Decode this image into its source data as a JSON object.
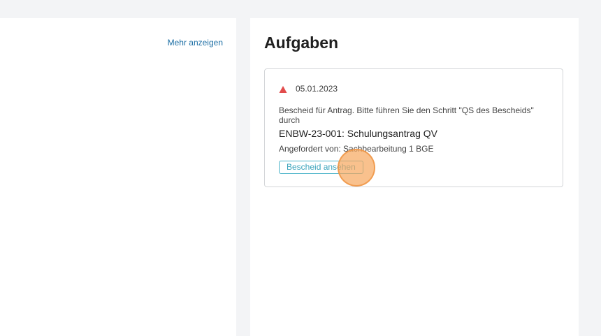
{
  "left_panel": {
    "more_link": "Mehr anzeigen"
  },
  "tasks_panel": {
    "title": "Aufgaben",
    "task": {
      "icon": "warning-triangle-icon",
      "icon_color": "#e24c4c",
      "date": "05.01.2023",
      "description": "Bescheid für Antrag. Bitte führen Sie den Schritt \"QS des Bescheids\" durch",
      "title": "ENBW-23-001: Schulungsantrag QV",
      "requested_by": "Angefordert von: Sachbearbeitung 1 BGE",
      "button_label": "Bescheid ansehen"
    }
  },
  "colors": {
    "link": "#1d6fa5",
    "button_border": "#4ab3c9",
    "click_highlight": "#f7a65c",
    "background": "#f3f4f6"
  }
}
